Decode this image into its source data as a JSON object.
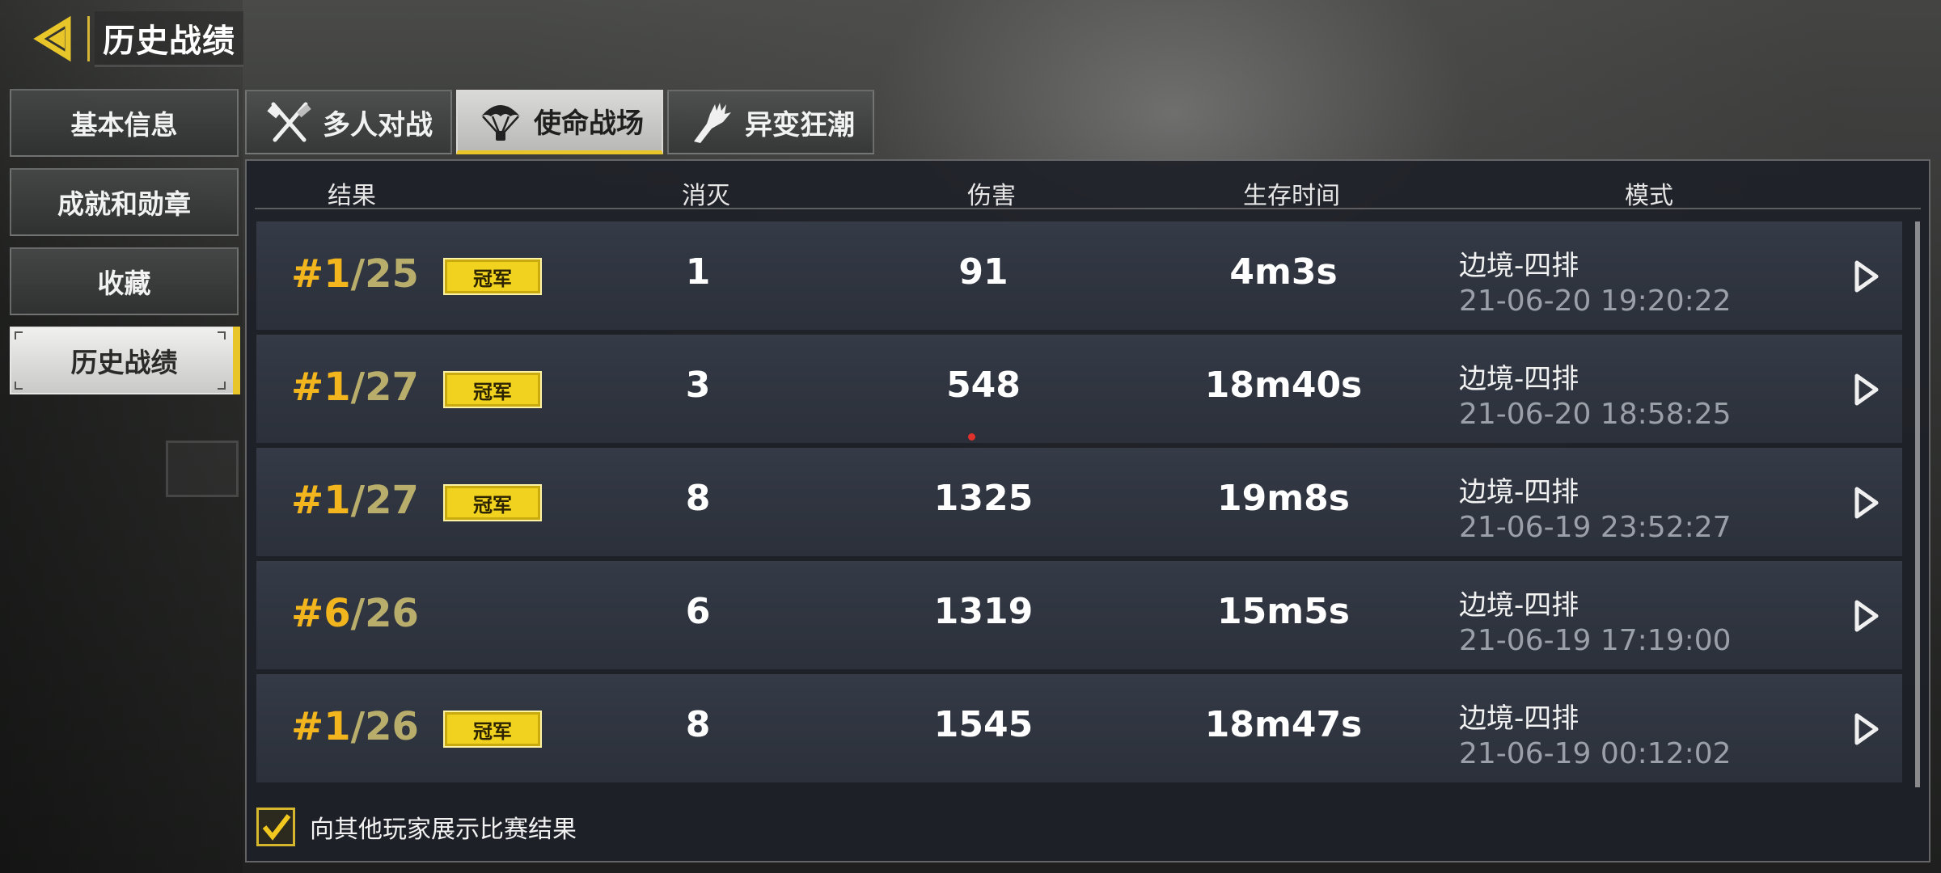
{
  "header": {
    "title": "历史战绩"
  },
  "sidebar": {
    "items": [
      {
        "label": "基本信息",
        "active": false
      },
      {
        "label": "成就和勋章",
        "active": false
      },
      {
        "label": "收藏",
        "active": false
      },
      {
        "label": "历史战绩",
        "active": true
      }
    ]
  },
  "tabs": [
    {
      "label": "多人对战",
      "icon": "crossed-weapons-icon",
      "active": false
    },
    {
      "label": "使命战场",
      "icon": "parachute-icon",
      "active": true
    },
    {
      "label": "异变狂潮",
      "icon": "claw-arm-icon",
      "active": false
    }
  ],
  "table": {
    "columns": {
      "result": "结果",
      "kills": "消灭",
      "damage": "伤害",
      "survival": "生存时间",
      "mode": "模式"
    },
    "rows": [
      {
        "place": "#1",
        "total": "/25",
        "badge": "冠军",
        "kills": "1",
        "damage": "91",
        "survival": "4m3s",
        "mode": "边境-四排",
        "time": "21-06-20 19:20:22"
      },
      {
        "place": "#1",
        "total": "/27",
        "badge": "冠军",
        "kills": "3",
        "damage": "548",
        "survival": "18m40s",
        "mode": "边境-四排",
        "time": "21-06-20 18:58:25"
      },
      {
        "place": "#1",
        "total": "/27",
        "badge": "冠军",
        "kills": "8",
        "damage": "1325",
        "survival": "19m8s",
        "mode": "边境-四排",
        "time": "21-06-19 23:52:27"
      },
      {
        "place": "#6",
        "total": "/26",
        "badge": "",
        "kills": "6",
        "damage": "1319",
        "survival": "15m5s",
        "mode": "边境-四排",
        "time": "21-06-19 17:19:00"
      },
      {
        "place": "#1",
        "total": "/26",
        "badge": "冠军",
        "kills": "8",
        "damage": "1545",
        "survival": "18m47s",
        "mode": "边境-四排",
        "time": "21-06-19 00:12:02"
      }
    ]
  },
  "footer": {
    "show_results_label": "向其他玩家展示比赛结果",
    "show_results_checked": true
  },
  "colors": {
    "accent": "#e8c629",
    "place": "#f2b51d",
    "total": "#b9ad6c",
    "badge": "#f0d21f"
  }
}
